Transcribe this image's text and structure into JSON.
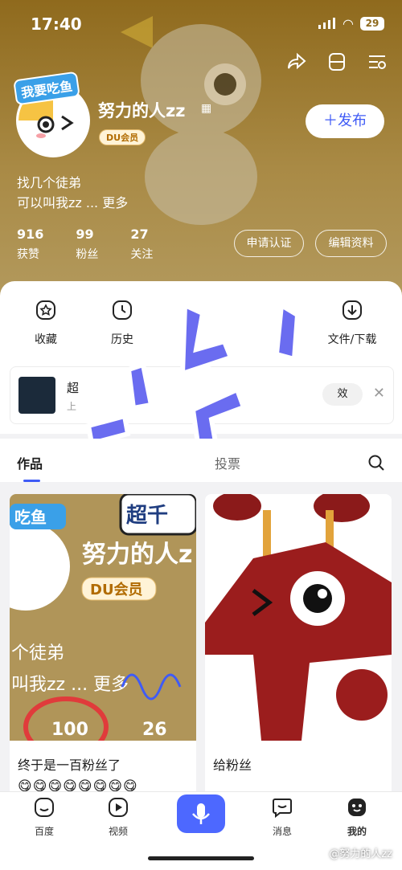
{
  "status_bar": {
    "time": "17:40",
    "battery": "29"
  },
  "profile": {
    "name": "努力的人zz",
    "badge": "DU会员",
    "avatar_banner": "我要吃鱼",
    "publish": "＋发布",
    "bio_line1": "找几个徒弟",
    "bio_line2": "可以叫我zz ... 更多",
    "stats": [
      {
        "n": "916",
        "l": "获赞"
      },
      {
        "n": "99",
        "l": "粉丝"
      },
      {
        "n": "27",
        "l": "关注"
      }
    ],
    "btn_cert": "申请认证",
    "btn_edit": "编辑资料"
  },
  "quick_actions": [
    {
      "label": "收藏"
    },
    {
      "label": "历史"
    },
    {
      "label": "文件/下载"
    }
  ],
  "recent": {
    "title": "超",
    "sub": "上",
    "pill": "效"
  },
  "tabs": [
    "作品",
    "投票"
  ],
  "posts": [
    {
      "caption": "终于是一百粉丝了",
      "img_text_name": "努力的人z",
      "img_badge": "DU会员",
      "img_bio1": "个徒弟",
      "img_bio2": "叫我zz ... 更多",
      "img_banner": "吃鱼",
      "img_top": "超千",
      "img_stat1": "100",
      "img_stat2": "26",
      "emojis": "😋😋😋😋😋😋😋😋"
    },
    {
      "caption": "给粉丝"
    }
  ],
  "bottom_nav": [
    {
      "label": "百度"
    },
    {
      "label": "视频"
    },
    {
      "label": "消息"
    },
    {
      "label": "我的"
    }
  ],
  "watermark": "@努力的人zz",
  "colors": {
    "accent": "#3f5bf6",
    "hero": "#8f6a1d"
  }
}
